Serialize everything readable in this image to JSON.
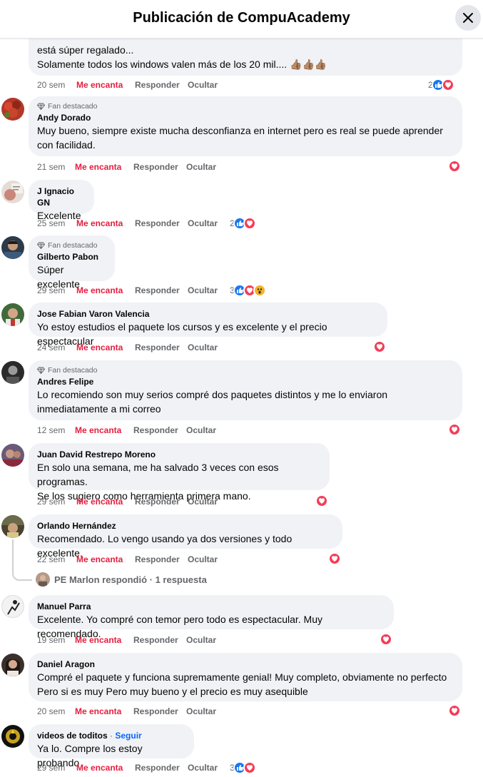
{
  "header": {
    "title": "Publicación de CompuAcademy"
  },
  "actions": {
    "love": "Me encanta",
    "reply": "Responder",
    "hide": "Ocultar"
  },
  "colors": {
    "love": "#e41e3f",
    "like": "#1877f2",
    "bubble": "#f0f2f5",
    "link": "#0866ff"
  },
  "comments": [
    {
      "badge": "",
      "author": "",
      "text": "está súper regalado...\nSolamente todos los windows valen más de los 20 mil.... 👍🏽👍🏽👍🏽",
      "time": "20 sem",
      "reactions_count": "2",
      "reactions": [
        "like",
        "love"
      ]
    },
    {
      "badge": "Fan destacado",
      "author": "Andy Dorado",
      "text": "Muy bueno, siempre existe mucha desconfianza en internet pero es real se puede aprender\ncon facilidad.",
      "time": "21 sem",
      "reactions_count": "",
      "reactions": [
        "love"
      ]
    },
    {
      "badge": "",
      "author": "J Ignacio GN",
      "text": "Excelente",
      "time": "25 sem",
      "reactions_count": "2",
      "reactions": [
        "like",
        "love"
      ]
    },
    {
      "badge": "Fan destacado",
      "author": "Gilberto Pabon",
      "text": "Súper excelente",
      "time": "29 sem",
      "reactions_count": "3",
      "reactions": [
        "like",
        "love",
        "wow"
      ]
    },
    {
      "badge": "",
      "author": "Jose Fabian Varon Valencia",
      "text": "Yo estoy estudios el paquete los cursos y es excelente y el precio espectacular",
      "time": "24 sem",
      "reactions_count": "",
      "reactions": [
        "love"
      ]
    },
    {
      "badge": "Fan destacado",
      "author": "Andres Felipe",
      "text": "Lo recomiendo son muy serios compré dos paquetes distintos y me lo enviaron\ninmediatamente a mi correo",
      "time": "12 sem",
      "reactions_count": "",
      "reactions": [
        "love"
      ]
    },
    {
      "badge": "",
      "author": "Juan David Restrepo Moreno",
      "text": "En solo una semana, me ha salvado 3 veces con esos programas.\nSe los sugiero como herramienta primera mano.",
      "time": "29 sem",
      "reactions_count": "",
      "reactions": [
        "love"
      ]
    },
    {
      "badge": "",
      "author": "Orlando Hernández",
      "text": "Recomendado. Lo vengo usando ya dos versiones y todo excelente.",
      "time": "22 sem",
      "reactions_count": "",
      "reactions": [
        "love"
      ]
    },
    {
      "badge": "",
      "author": "Manuel Parra",
      "text": "Excelente. Yo compré con temor pero todo es espectacular. Muy recomendado.",
      "time": "19 sem",
      "reactions_count": "",
      "reactions": [
        "love"
      ]
    },
    {
      "badge": "",
      "author": "Daniel Aragon",
      "text": "Compré el paquete y funciona supremamente genial! Muy completo, obviamente no perfecto\nPero si es muy Pero muy bueno y el precio es muy asequible",
      "time": "20 sem",
      "reactions_count": "",
      "reactions": [
        "love"
      ]
    },
    {
      "badge": "",
      "author": "videos de toditos",
      "follow": "Seguir",
      "text": "Ya lo. Compre los estoy probando",
      "time": "29 sem",
      "reactions_count": "3",
      "reactions": [
        "like",
        "love"
      ]
    }
  ],
  "reply_summary": {
    "text": "PE Marlon respondió · 1 respuesta"
  }
}
